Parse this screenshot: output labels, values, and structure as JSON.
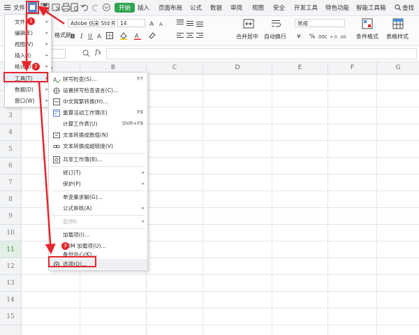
{
  "title_bar": {
    "menu_label": "文件",
    "tabs": [
      "开始",
      "插入",
      "页面布局",
      "公式",
      "数据",
      "审阅",
      "视图",
      "安全",
      "开发工具",
      "特色功能",
      "智能工具箱"
    ],
    "search_label": "查找"
  },
  "ribbon": {
    "font_name": "Adobe 仿宋 Std R",
    "font_size": "14",
    "format_painter": "格式刷",
    "merge_center": "合并居中",
    "auto_wrap": "自动换行",
    "number_format": "常规",
    "conditional_format": "条件格式",
    "table_style": "表格样式"
  },
  "formula_bar": {
    "fx_label": "fx"
  },
  "columns": [
    "A",
    "B",
    "C",
    "D",
    "E",
    "F",
    "G"
  ],
  "rows": [
    "1",
    "2",
    "3",
    "4",
    "5",
    "6",
    "7",
    "8",
    "9",
    "10",
    "11",
    "12",
    "13",
    "14",
    "15"
  ],
  "active_row": "11",
  "file_menu": {
    "items": [
      {
        "label": "文件(F)"
      },
      {
        "label": "编辑(E)"
      },
      {
        "label": "视图(V)"
      },
      {
        "label": "插入(I)"
      },
      {
        "label": "格式(O)"
      },
      {
        "label": "工具(T)"
      },
      {
        "label": "数据(D)"
      },
      {
        "label": "窗口(W)"
      }
    ]
  },
  "tools_menu": {
    "items": [
      {
        "label": "拼写检查(S)...",
        "shortcut": "F7"
      },
      {
        "label": "设置拼写检查语言(C)...",
        "shortcut": ""
      },
      {
        "label": "中文简繁转换(H)...",
        "shortcut": ""
      },
      {
        "label": "重算活动工作簿(E)",
        "shortcut": "F9"
      },
      {
        "label": "计算工作表(U)",
        "shortcut": "Shift+F9"
      },
      {
        "label": "文本转换成数值(N)",
        "shortcut": ""
      },
      {
        "label": "文本转换成超链接(V)",
        "shortcut": ""
      },
      {
        "label": "共享工作簿(B)...",
        "shortcut": ""
      },
      {
        "label": "修订(T)",
        "shortcut": ""
      },
      {
        "label": "保护(P)",
        "shortcut": ""
      },
      {
        "label": "单变量求解(G)...",
        "shortcut": ""
      },
      {
        "label": "公式审核(A)",
        "shortcut": ""
      },
      {
        "label": "宏(M)",
        "shortcut": ""
      },
      {
        "label": "加载项(I)...",
        "shortcut": ""
      },
      {
        "label": "COM 加载项(U)...",
        "shortcut": ""
      },
      {
        "label": "备份中心(K)...",
        "shortcut": ""
      },
      {
        "label": "选项(O)...",
        "shortcut": ""
      }
    ]
  },
  "callouts": [
    "1",
    "2",
    "3"
  ],
  "colors": {
    "accent": "#2ea44f",
    "highlight": "#e5262b"
  }
}
